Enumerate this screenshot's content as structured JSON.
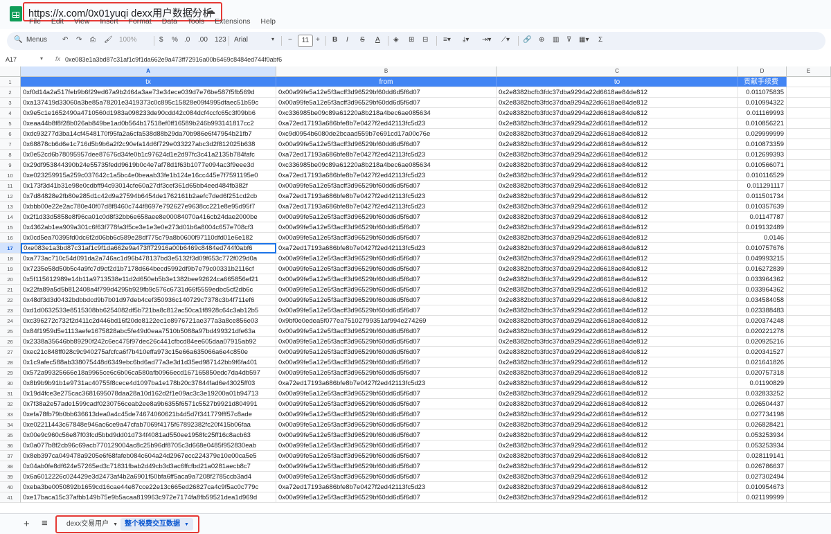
{
  "title": {
    "text": "https://x.com/0x01yuqi  dexx用户数据分析"
  },
  "menus": [
    "File",
    "Edit",
    "View",
    "Insert",
    "Format",
    "Data",
    "Tools",
    "Extensions",
    "Help"
  ],
  "toolbar": {
    "menus_label": "Menus",
    "zoom": "100%",
    "currency": "$",
    "percent": "%",
    "dec_less": ".0",
    "dec_more": ".00",
    "num_format": "123",
    "font": "Arial",
    "font_size": "11"
  },
  "formula": {
    "cell_ref": "A17",
    "fx": "fx",
    "content": "0xe083e1a3bd87c31af1c9f1da662e9a473ff72916a00b6469c8484ed744f0abf6"
  },
  "columns": [
    {
      "letter": "A"
    },
    {
      "letter": "B"
    },
    {
      "letter": "C"
    },
    {
      "letter": "D"
    },
    {
      "letter": "E"
    }
  ],
  "headers": [
    "tx",
    "from",
    "to",
    "贡献手续费"
  ],
  "rows": [
    [
      "0xf0d14a2a517feb9b6f29ed67a9b2464a3ae73e34ece039d7e76be587f5fb569d",
      "0x00a99fe5a12e5f3acff3d96529bf60dd6d5f6d07",
      "0x2e8382bcfb3fdc37dba9294a22d6618ae84de812",
      "0.011075835"
    ],
    [
      "0xa137419d33060a3be85a78201e3419373c0c895c15828e09f4995dfaec51b59c",
      "0x00a99fe5a12e5f3acff3d96529bf60dd6d5f6d07",
      "0x2e8382bcfb3fdc37dba9294a22d6618ae84de812",
      "0.010994322"
    ],
    [
      "0x9e5c1e1652490a4710560d1983a098233de90cdd42c084dcf4ccfc65c3f09bb6",
      "0xc336985be09c89a61220a8b218a4bec6ae085634",
      "0x2e8382bcfb3fdc37dba9294a22d6618ae84de812",
      "0.011169993"
    ],
    [
      "0xeaa44b8f8f28b026ab849be1ad0b564b17518ef0ff16589b246b993141817cc2",
      "0xa72ed17193a686bfe8b7e0427f2ed42113fc5d23",
      "0x2e8382bcfb3fdc37dba9294a22d6618ae84de812",
      "0.010856221"
    ],
    [
      "0xdc93277d3ba14cf4548170f95fa2a6cfa538d88b29da70b986e6f47954b21fb7",
      "0xc9d0954b6080de2bcaad559b7e691cd17a00c76e",
      "0x2e8382bcfb3fdc37dba9294a22d6618ae84de812",
      "0.029999999"
    ],
    [
      "0x68878cb6d6e1c716d5b9b6a2f2c90efa14d6f729e033227abc3d2f812025b638",
      "0x00a99fe5a12e5f3acff3d96529bf60dd6d5f6d07",
      "0x2e8382bcfb3fdc37dba9294a22d6618ae84de812",
      "0.010873359"
    ],
    [
      "0x0e52cd6b78095957dee87676d34fe0b1c97624d1e2d97fc3c41a2135b784fafc",
      "0xa72ed17193a686bfe8b7e0427f2ed42113fc5d23",
      "0x2e8382bcfb3fdc37dba9294a22d6618ae84de812",
      "0.012699393"
    ],
    [
      "0x29df953844390b24e55735fedd9619b0c4e7af78d1f63b1077e094ac3f9eee3d",
      "0xc336985be09c89a61220a8b218a4bec6ae085634",
      "0x2e8382bcfb3fdc37dba9294a22d6618ae84de812",
      "0.010566071"
    ],
    [
      "0xe023259915a259c037642c1a5bc4e0beaab33fe1b124e16cc445e7f7591195e0",
      "0xa72ed17193a686bfe8b7e0427f2ed42113fc5d23",
      "0x2e8382bcfb3fdc37dba9294a22d6618ae84de812",
      "0.010116529"
    ],
    [
      "0x173f3d41b31e98e0cdbff94c93014cfe60a27df3cef361d65bb4eed484fb382f",
      "0x00a99fe5a12e5f3acff3d96529bf60dd6d5f6d07",
      "0x2e8382bcfb3fdc37dba9294a22d6618ae84de812",
      "0.011291117"
    ],
    [
      "0x7d84828e2fb80e285d1c42d9a27594b6454de1762161b2aefc7ded6f251cd2cb",
      "0xa72ed17193a686bfe8b7e0427f2ed42113fc5d23",
      "0x2e8382bcfb3fdc37dba9294a22d6618ae84de812",
      "0.011501734"
    ],
    [
      "0xbbb00e22e2ac780e40f07d8f8460c744f8697e792627e9638cc221e8e95d95f7",
      "0xa72ed17193a686bfe8b7e0427f2ed42113fc5d23",
      "0x2e8382bcfb3fdc37dba9294a22d6618ae84de812",
      "0.010357639"
    ],
    [
      "0x2f1d33d5858e8f96ca01c0d8f32bb6e658aee8e00084070a416cb24dae2000be",
      "0x00a99fe5a12e5f3acff3d96529bf60dd6d5f6d07",
      "0x2e8382bcfb3fdc37dba9294a22d6618ae84de812",
      "0.01147787"
    ],
    [
      "0x4362ab1ea909a301c6f63f778fa3f5ce3e1e3e0e273d01b6a8004c657e708cf3",
      "0x00a99fe5a12e5f3acff3d96529bf60dd6d5f6d07",
      "0x2e8382bcfb3fdc37dba9294a22d6618ae84de812",
      "0.019132489"
    ],
    [
      "0x0cd5ea70395fd0dc6f2d06bb6c589e28df775c79a8b0600f97110dfd01e6e182",
      "0x00a99fe5a12e5f3acff3d96529bf60dd6d5f6d07",
      "0x2e8382bcfb3fdc37dba9294a22d6618ae84de812",
      "0.0146"
    ],
    [
      "0xe083e1a3bd87c31af1c9f1da662e9a473ff72916a00b6469c8484ed744f0abf6",
      "0xa72ed17193a686bfe8b7e0427f2ed42113fc5d23",
      "0x2e8382bcfb3fdc37dba9294a22d6618ae84de812",
      "0.010757676"
    ],
    [
      "0xa773ac710c54d091da2a746ac1d96b478137bd3e5132f3d09f653c772f029d0a",
      "0x00a99fe5a12e5f3acff3d96529bf60dd6d5f6d07",
      "0x2e8382bcfb3fdc37dba9294a22d6618ae84de812",
      "0.049993215"
    ],
    [
      "0x7235e58d50b5c4a9fc7d9cf2d1b7178d664becd5992df9b7e79c00331b2116cf",
      "0x00a99fe5a12e5f3acff3d96529bf60dd6d5f6d07",
      "0x2e8382bcfb3fdc37dba9294a22d6618ae84de812",
      "0.016272839"
    ],
    [
      "0x5f115612989e14b11a9713538e11d2d650eb5b3e1382bee92624ca665856ef21",
      "0x00a99fe5a12e5f3acff3d96529bf60dd6d5f6d07",
      "0x2e8382bcfb3fdc37dba9294a22d6618ae84de812",
      "0.033964362"
    ],
    [
      "0x22fa89a5d5b812408a4f799d4295b929fb9c576c6731d66f5559edbc5cf2db6c",
      "0x00a99fe5a12e5f3acff3d96529bf60dd6d5f6d07",
      "0x2e8382bcfb3fdc37dba9294a22d6618ae84de812",
      "0.033964362"
    ],
    [
      "0x48df3d3d0432bdbbdcd9b7b01d97deb4cef350936c140729c7378c3b4f711ef6",
      "0x00a99fe5a12e5f3acff3d96529bf60dd6d5f6d07",
      "0x2e8382bcfb3fdc37dba9294a22d6618ae84de812",
      "0.034584058"
    ],
    [
      "0xd1d0632533e8515308bb6254082df5b721ba8c812ac50ca1f8928c64c3ab12b5",
      "0x00a99fe5a12e5f3acff3d96529bf60dd6d5f6d07",
      "0x2e8382bcfb3fdc37dba9294a22d6618ae84de812",
      "0.023388483"
    ],
    [
      "0xc396272c732f2d411c2d446bd16f20de8122ec1e8976721ae377a3a8ce856e03",
      "0x9bf0e0edea5f077ea75102799351af994e274269",
      "0x2e8382bcfb3fdc37dba9294a22d6618ae84de812",
      "0.020374248"
    ],
    [
      "0x84f1959d5e1113aefe1675828abc5fe49d0eaa7510b5088a97bd499321dfe63a",
      "0x00a99fe5a12e5f3acff3d96529bf60dd6d5f6d07",
      "0x2e8382bcfb3fdc37dba9294a22d6618ae84de812",
      "0.020221278"
    ],
    [
      "0x2338a35646bb89290f242c6ec475f97dec26c441cfbcd84ee605daa07915ab92",
      "0x00a99fe5a12e5f3acff3d96529bf60dd6d5f6d07",
      "0x2e8382bcfb3fdc37dba9294a22d6618ae84de812",
      "0.020925216"
    ],
    [
      "0xec21c848ff028c9c940275afcfca6f7b410effa973c15e66a635066a6e4c850e",
      "0x00a99fe5a12e5f3acff3d96529bf60dd6d5f6d07",
      "0x2e8382bcfb3fdc37dba9294a22d6618ae84de812",
      "0.020341527"
    ],
    [
      "0x1c9afec588ab338075448d6349ebc6bd6ad77a3e3d1d35ed987142bb9f6fa401",
      "0x00a99fe5a12e5f3acff3d96529bf60dd6d5f6d07",
      "0x2e8382bcfb3fdc37dba9294a22d6618ae84de812",
      "0.021641826"
    ],
    [
      "0x572a99325666e18a9965ce6c6b06ca580afb0966ecd167165850edc7da4db597",
      "0x00a99fe5a12e5f3acff3d96529bf60dd6d5f6d07",
      "0x2e8382bcfb3fdc37dba9294a22d6618ae84de812",
      "0.020757318"
    ],
    [
      "0x8b9b9b91b1e9731ac40755f8cece4d1097ba1e178b20c37844fad6e43025ff03",
      "0xa72ed17193a686bfe8b7e0427f2ed42113fc5d23",
      "0x2e8382bcfb3fdc37dba9294a22d6618ae84de812",
      "0.01190829"
    ],
    [
      "0x19d4fce3e275cac3681695078daa28a10d162d2f1e09ac3c3e19200a01b94713",
      "0x00a99fe5a12e5f3acff3d96529bf60dd6d5f6d07",
      "0x2e8382bcfb3fdc37dba9294a22d6618ae84de812",
      "0.032833252"
    ],
    [
      "0x7f38a2e57ade1599cadf0230756ceab2ee8a9b6355f6571c5527b9921d804991",
      "0x00a99fe5a12e5f3acff3d96529bf60dd6d5f6d07",
      "0x2e8382bcfb3fdc37dba9294a22d6618ae84de812",
      "0.026504437"
    ],
    [
      "0xefa78fb79b0bb636613dea0a4c45de74674060621b4d5d7f341779fff57c8ade",
      "0x00a99fe5a12e5f3acff3d96529bf60dd6d5f6d07",
      "0x2e8382bcfb3fdc37dba9294a22d6618ae84de812",
      "0.027734198"
    ],
    [
      "0xe02211443c67848e946ac6ce9a47cfab7069f4175f67892382fc20f415b06faa",
      "0x00a99fe5a12e5f3acff3d96529bf60dd6d5f6d07",
      "0x2e8382bcfb3fdc37dba9294a22d6618ae84de812",
      "0.026828421"
    ],
    [
      "0x00e9c960c56e87f03fcd5bbd9dd01d734f4081ad550ee1958fc25ff16c8acb63",
      "0x00a99fe5a12e5f3acff3d96529bf60dd6d5f6d07",
      "0x2e8382bcfb3fdc37dba9294a22d6618ae84de812",
      "0.053253934"
    ],
    [
      "0x0a077b8f2cb96c69acb770129004ac8c25b96df8705c3d668e0485f952830eab",
      "0x00a99fe5a12e5f3acff3d96529bf60dd6d5f6d07",
      "0x2e8382bcfb3fdc37dba9294a22d6618ae84de812",
      "0.053253934"
    ],
    [
      "0x8eb397ca049478a9205e6f68fafeb084c604a24d2967ecc224379e10e00ca5e5",
      "0x00a99fe5a12e5f3acff3d96529bf60dd6d5f6d07",
      "0x2e8382bcfb3fdc37dba9294a22d6618ae84de812",
      "0.028119141"
    ],
    [
      "0x04ab0fe8df624e57265ed3c71831fbab2d49cb3d3ac6ffcfbd21a0281aecb8c7",
      "0x00a99fe5a12e5f3acff3d96529bf60dd6d5f6d07",
      "0x2e8382bcfb3fdc37dba9294a22d6618ae84de812",
      "0.026786637"
    ],
    [
      "0x6a6012226c024429e3d2473af4b2a6901f50bfa6ff5aca9a7208f2785ccb3ad4",
      "0x00a99fe5a12e5f3acff3d96529bf60dd6d5f6d07",
      "0x2e8382bcfb3fdc37dba9294a22d6618ae84de812",
      "0.027302494"
    ],
    [
      "0xeba3be0050892b1659cd16cae44e87cce22e13c665ed26827ca4c9f5ac0c779c",
      "0xa72ed17193a686bfe8b7e0427f2ed42113fc5d23",
      "0x2e8382bcfb3fdc37dba9294a22d6618ae84de812",
      "0.010954673"
    ],
    [
      "0xe17baca15c37afbb149b75e9b5acaa819963c972e7174fa8fb59521dea1d969d",
      "0x00a99fe5a12e5f3acff3d96529bf60dd6d5f6d07",
      "0x2e8382bcfb3fdc37dba9294a22d6618ae84de812",
      "0.021199999"
    ]
  ],
  "sheets": [
    {
      "label": "dexx交易用户",
      "active": false
    },
    {
      "label": "整个税费交互数据",
      "active": true
    }
  ],
  "active_row": 17,
  "colors": {
    "header_bg": "#4285f4",
    "selection": "#1a73e8",
    "highlight_box": "#e53935"
  }
}
